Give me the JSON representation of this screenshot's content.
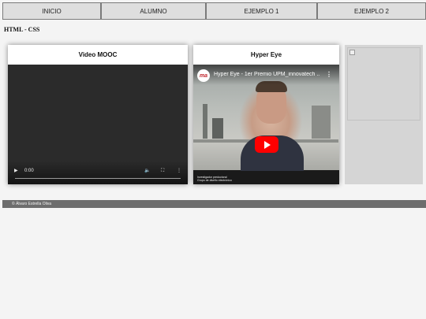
{
  "nav": {
    "items": [
      {
        "label": "INICIO"
      },
      {
        "label": "ALUMNO"
      },
      {
        "label": "EJEMPLO 1"
      },
      {
        "label": "EJEMPLO 2"
      }
    ]
  },
  "page": {
    "heading": "HTML - CSS"
  },
  "cards": {
    "mooc": {
      "title": "Video MOOC",
      "player": {
        "time": "0:00",
        "icons": [
          "play-icon",
          "volume-icon",
          "fullscreen-icon",
          "more-options-icon"
        ]
      }
    },
    "hyper": {
      "title": "Hyper Eye",
      "embed": {
        "video_title": "Hyper Eye - 1er Premio UPM_innovatech ...",
        "channel_logo_text": "ma",
        "caption_line1": "Investigador predoctoral",
        "caption_line2": "Grupo de diseño electrónico",
        "icons": [
          "youtube-play-icon",
          "more-options-icon"
        ]
      }
    }
  },
  "image_placeholder": {
    "icon": "broken-image-icon"
  },
  "footer": {
    "text": "© Álvaro Estrella Oliva"
  },
  "colors": {
    "nav_bg": "#dedede",
    "footer_bg": "#6d6d6d",
    "youtube_red": "#ff0000",
    "page_bg": "#f4f4f4"
  }
}
